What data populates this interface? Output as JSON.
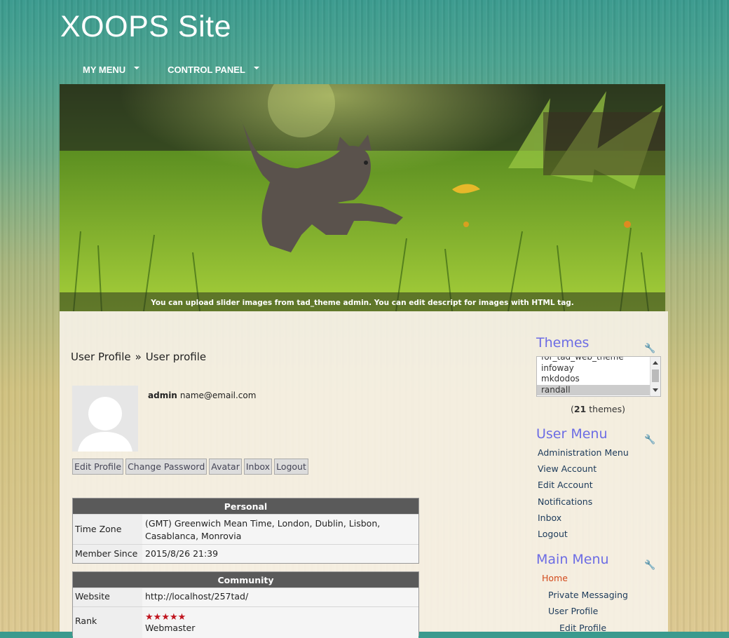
{
  "site": {
    "title": "XOOPS Site"
  },
  "nav": [
    {
      "label": "MY MENU"
    },
    {
      "label": "CONTROL PANEL"
    }
  ],
  "slider": {
    "caption": "You can upload slider images from tad_theme admin. You can edit descript for images with HTML tag."
  },
  "breadcrumb": {
    "root": "User Profile",
    "separator": "»",
    "current": "User profile"
  },
  "user": {
    "name": "admin",
    "email": "name@email.com"
  },
  "buttons": {
    "edit_profile": "Edit Profile",
    "change_password": "Change Password",
    "avatar": "Avatar",
    "inbox": "Inbox",
    "logout": "Logout"
  },
  "personal": {
    "heading": "Personal",
    "time_zone_label": "Time Zone",
    "time_zone_value_line1": "(GMT) Greenwich Mean Time, London, Dublin, Lisbon,",
    "time_zone_value_line2": "Casablanca, Monrovia",
    "member_since_label": "Member Since",
    "member_since_value": "2015/8/26 21:39"
  },
  "community": {
    "heading": "Community",
    "website_label": "Website",
    "website_value": "http://localhost/257tad/",
    "rank_label": "Rank",
    "rank_stars": 5,
    "rank_title": "Webmaster"
  },
  "themes_block": {
    "title": "Themes",
    "options": [
      "for_tad_web_theme",
      "infoway",
      "mkdodos",
      "randall"
    ],
    "selected": "randall",
    "count": "21",
    "count_suffix": " themes)",
    "count_prefix": "("
  },
  "user_menu": {
    "title": "User Menu",
    "items": [
      "Administration Menu",
      "View Account",
      "Edit Account",
      "Notifications",
      "Inbox",
      "Logout"
    ]
  },
  "main_menu": {
    "title": "Main Menu",
    "home": "Home",
    "items": [
      "Private Messaging",
      "User Profile",
      "Edit Profile"
    ]
  },
  "colors": {
    "accent": "#6c6ce4",
    "link": "#1c3a5a",
    "home": "#d34a1c",
    "table_head": "#5a5a5a",
    "star": "#c0141e"
  },
  "icons": {
    "block_settings": "wrench-icon",
    "dropdown": "caret-down-icon"
  }
}
